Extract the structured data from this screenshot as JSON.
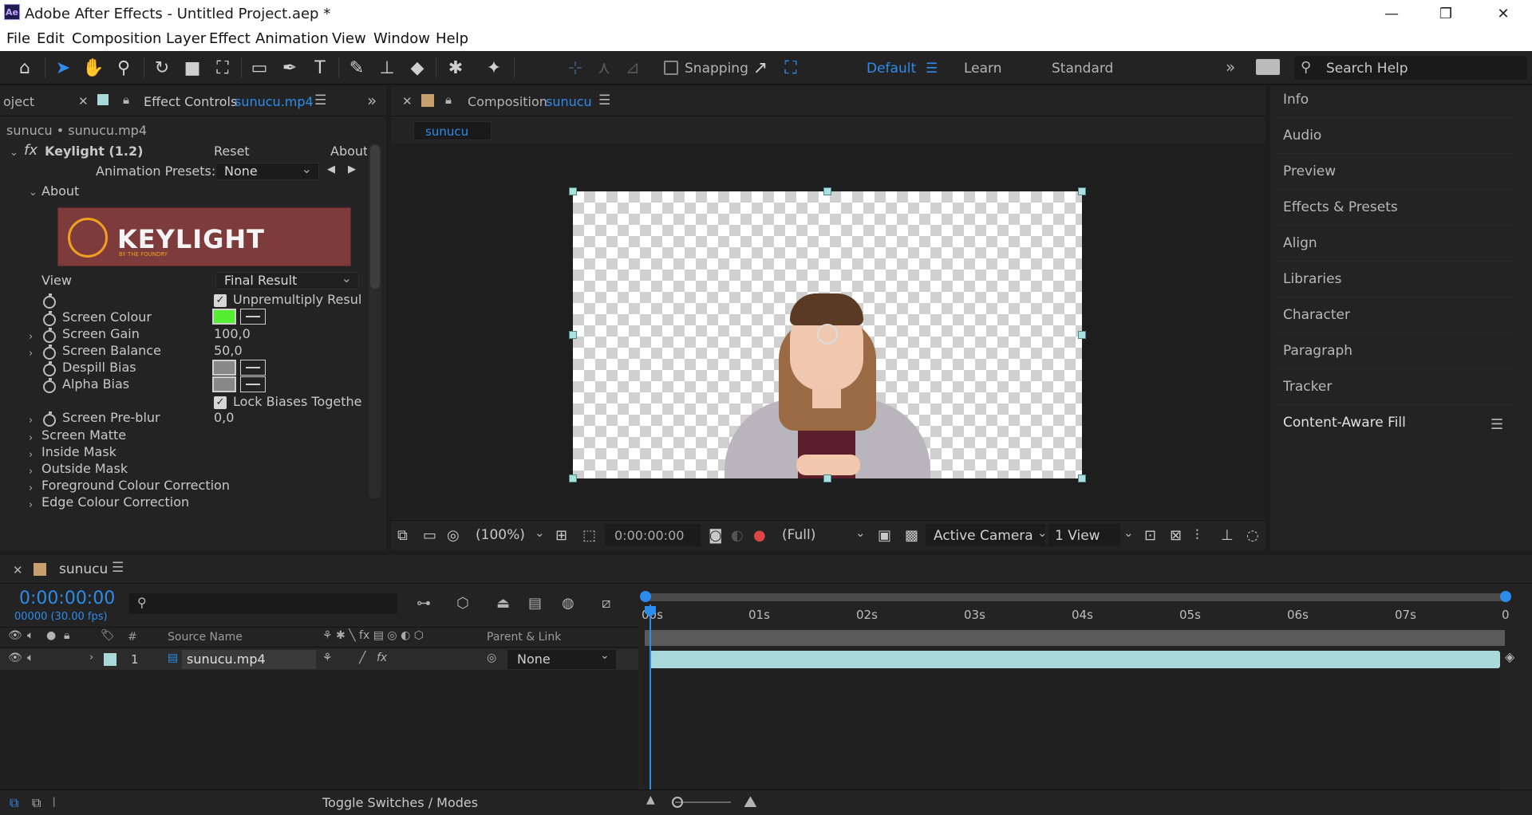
{
  "window": {
    "title": "Adobe After Effects - Untitled Project.aep *",
    "app_badge": "Ae"
  },
  "menu": [
    "File",
    "Edit",
    "Composition",
    "Layer",
    "Effect",
    "Animation",
    "View",
    "Window",
    "Help"
  ],
  "toolbar": {
    "snapping_label": "Snapping",
    "workspaces": {
      "active": "Default",
      "others": [
        "Learn",
        "Standard"
      ]
    },
    "search_placeholder": "Search Help"
  },
  "left_panel": {
    "project_tab": "oject",
    "effect_controls_tab": "Effect Controls",
    "effect_controls_file": "sunucu.mp4",
    "breadcrumb": "sunucu • sunucu.mp4",
    "effect": {
      "name": "Keylight (1.2)",
      "reset": "Reset",
      "about": "About",
      "animation_presets_label": "Animation Presets:",
      "animation_presets_value": "None",
      "about_section": "About",
      "logo_text": "KEYLIGHT",
      "logo_sub": "BY THE FOUNDRY",
      "view_label": "View",
      "view_value": "Final Result",
      "unpremultiply": "Unpremultiply Resul",
      "screen_colour": "Screen Colour",
      "screen_colour_hex": "#55ee33",
      "screen_gain_label": "Screen Gain",
      "screen_gain_value": "100,0",
      "screen_balance_label": "Screen Balance",
      "screen_balance_value": "50,0",
      "despill_bias": "Despill Bias",
      "alpha_bias": "Alpha Bias",
      "lock_biases": "Lock Biases Togethe",
      "screen_preblur_label": "Screen Pre-blur",
      "screen_preblur_value": "0,0",
      "groups": [
        "Screen Matte",
        "Inside Mask",
        "Outside Mask",
        "Foreground Colour Correction",
        "Edge Colour Correction"
      ]
    }
  },
  "composition": {
    "tab_label": "Composition",
    "comp_name": "sunucu",
    "subtab": "sunucu",
    "zoom": "(100%)",
    "timecode": "0:00:00:00",
    "resolution": "(Full)",
    "camera": "Active Camera",
    "views": "1 View"
  },
  "right_panels": [
    "Info",
    "Audio",
    "Preview",
    "Effects & Presets",
    "Align",
    "Libraries",
    "Character",
    "Paragraph",
    "Tracker",
    "Content-Aware Fill"
  ],
  "timeline": {
    "comp_name": "sunucu",
    "timecode": "0:00:00:00",
    "frames": "00000 (30.00 fps)",
    "search_placeholder": "",
    "ruler": [
      "00s",
      "01s",
      "02s",
      "03s",
      "04s",
      "05s",
      "06s",
      "07s",
      "0"
    ],
    "columns": {
      "num": "#",
      "source": "Source Name",
      "parent": "Parent & Link"
    },
    "layers": [
      {
        "index": "1",
        "name": "sunucu.mp4",
        "parent": "None",
        "label_color": "#a8d8d8"
      }
    ],
    "footer": "Toggle Switches / Modes"
  }
}
